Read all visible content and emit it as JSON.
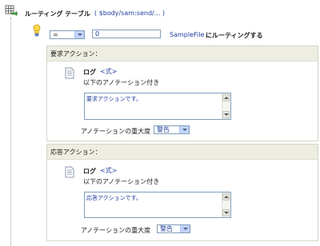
{
  "routing": {
    "title": "ルーティング テーブル",
    "expression": "( $body/sam:send/... )"
  },
  "condition": {
    "operator": "=",
    "value": "0",
    "target": "SampleFile",
    "target_suffix": " にルーティングする"
  },
  "request": {
    "header": "要求アクション：",
    "log_label": "ログ",
    "expr_link": "<式>",
    "annotation_label": "以下のアノテーション付き",
    "annotation_text": "要求アクションです。",
    "severity_label": "アノテーションの重大度",
    "severity_value": "警告"
  },
  "response": {
    "header": "応答アクション：",
    "log_label": "ログ",
    "expr_link": "<式>",
    "annotation_label": "以下のアノテーション付き",
    "annotation_text": "応答アクションです。",
    "severity_label": "アノテーションの重大度",
    "severity_value": "警告"
  },
  "colors": {
    "link": "#1f3c9c",
    "panel_header": "#eeede2",
    "input_border": "#7f9db9"
  },
  "icons": {
    "routing": "routing-table-icon",
    "condition": "condition-lightbulb-icon",
    "log": "log-document-icon"
  }
}
